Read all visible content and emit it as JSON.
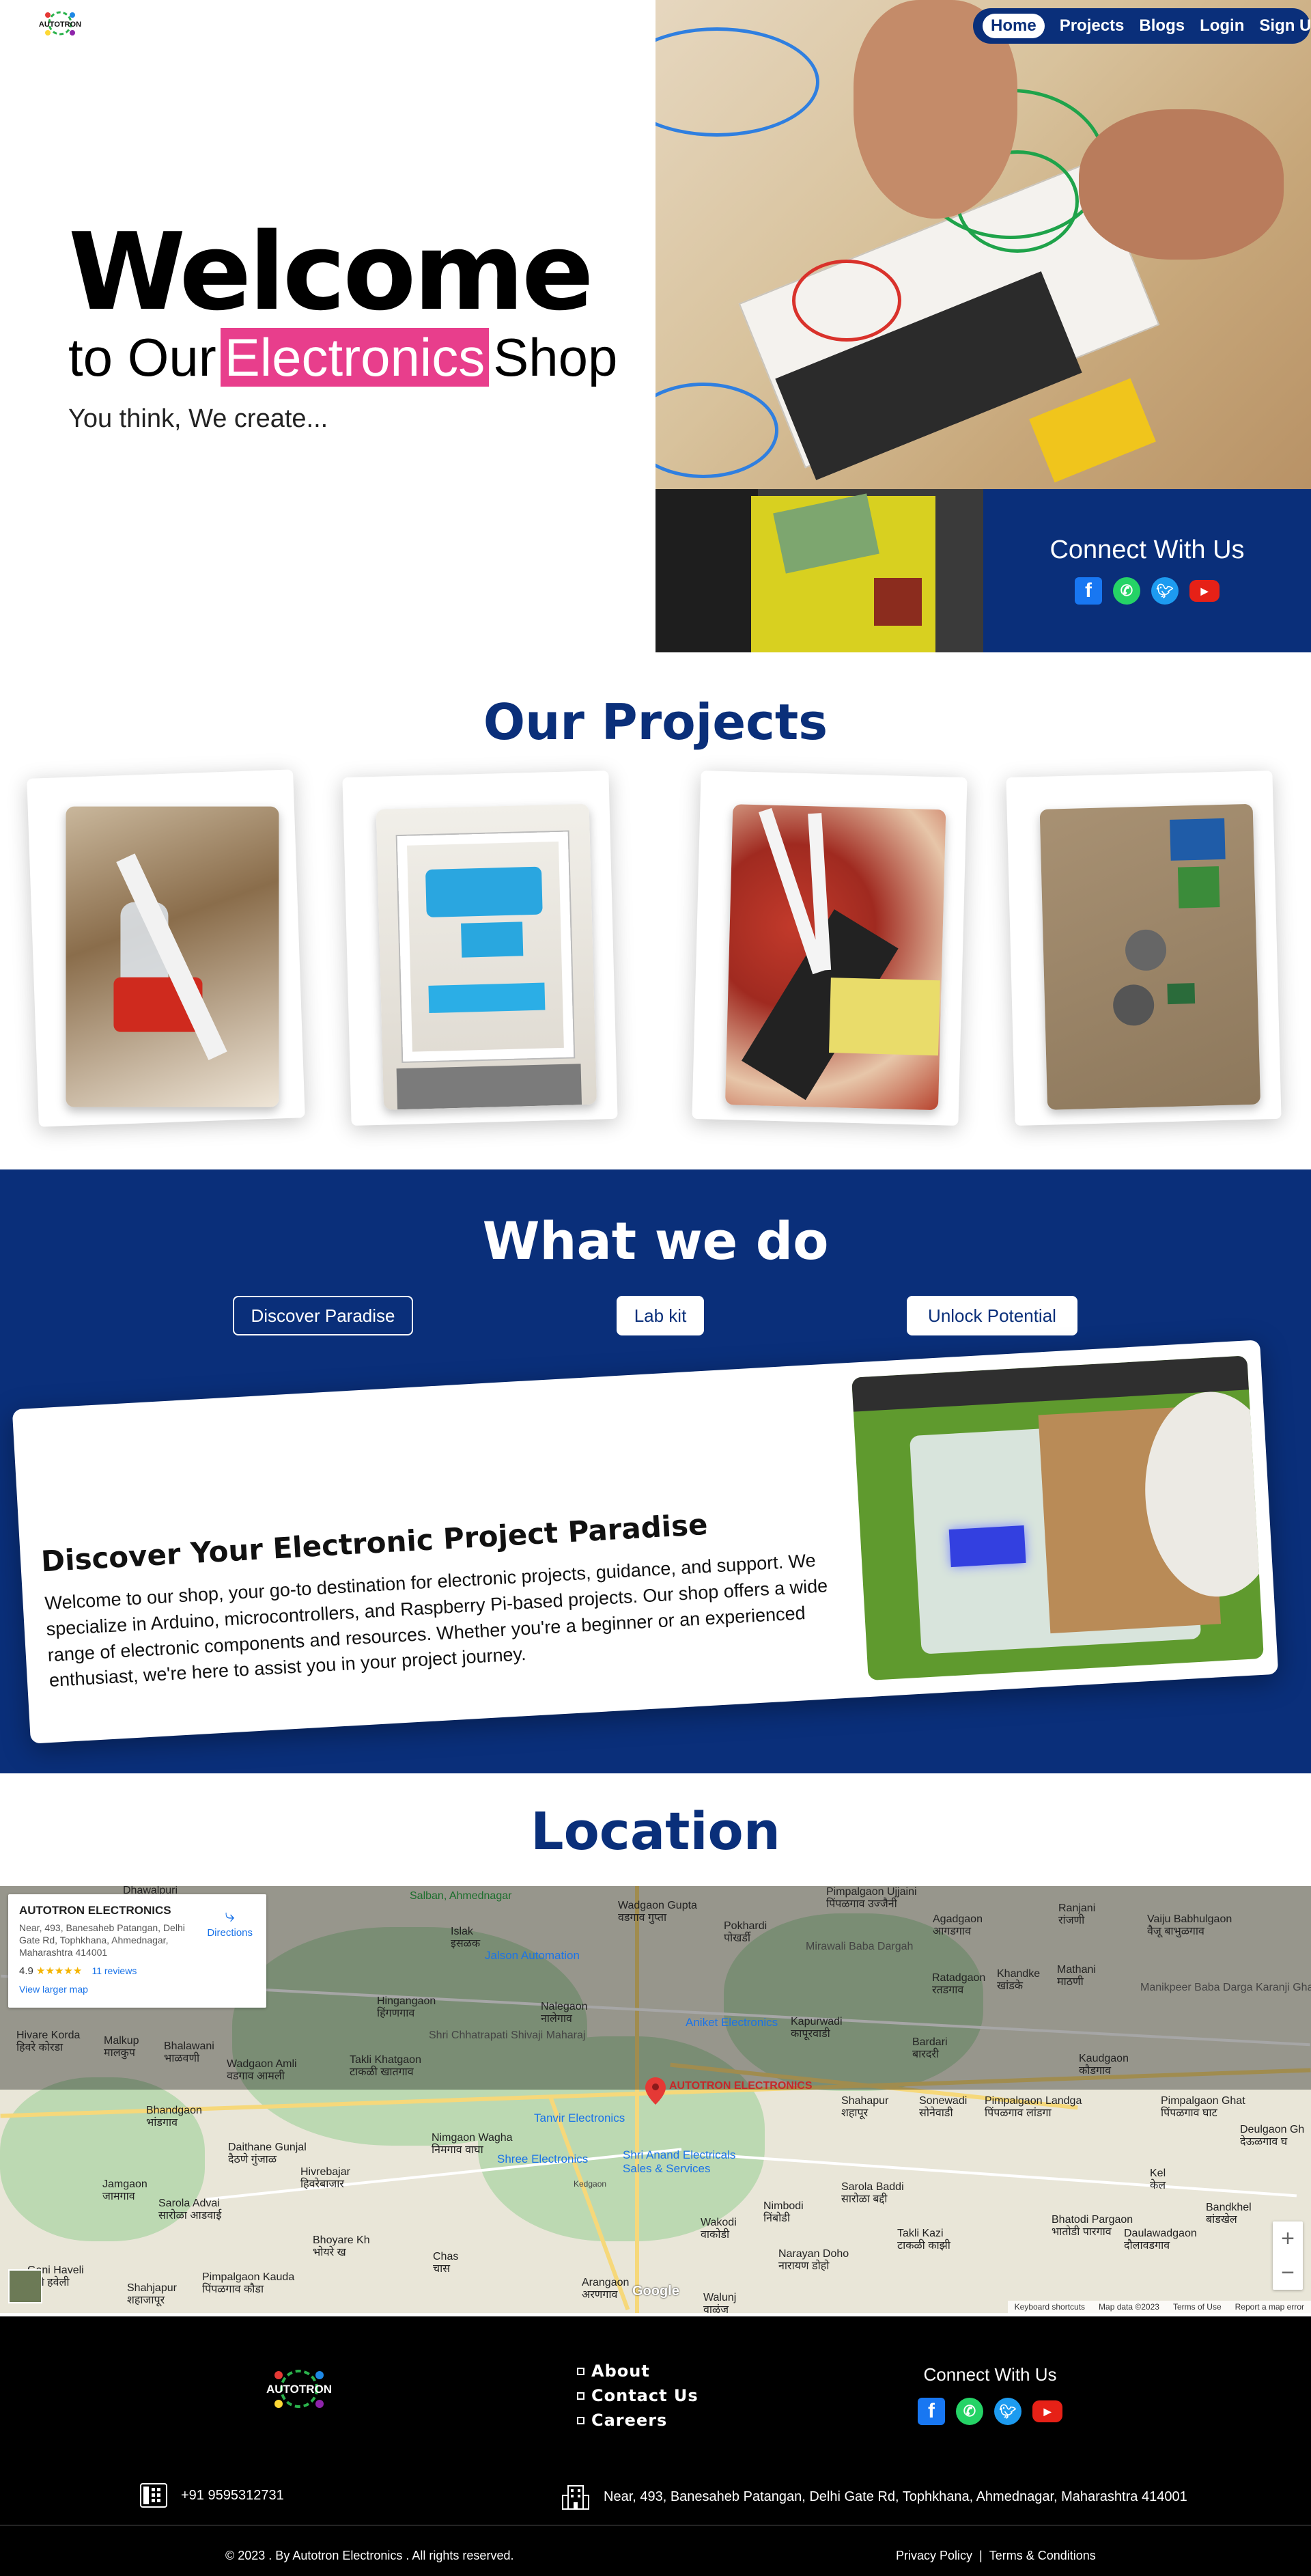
{
  "nav": {
    "items": [
      "Home",
      "Projects",
      "Blogs",
      "Login",
      "Sign Up"
    ],
    "active": "Home"
  },
  "logo": {
    "text": "AUTOTRON"
  },
  "hero": {
    "headline": "Welcome",
    "sub_prefix": "to Our",
    "sub_highlight": "Electronics",
    "sub_suffix": "Shop",
    "tagline": "You think, We create...",
    "highlight_color": "#e83e8c"
  },
  "connect": {
    "title": "Connect With Us",
    "icons": [
      "facebook-icon",
      "whatsapp-icon",
      "twitter-icon",
      "youtube-icon"
    ]
  },
  "projects": {
    "title": "Our Projects"
  },
  "what_we_do": {
    "title": "What we do",
    "tabs": [
      "Discover Paradise",
      "Lab kit",
      "Unlock Potential"
    ],
    "selected_tab": "Discover Paradise",
    "card_title": "Discover Your Electronic Project Paradise",
    "card_text": "Welcome to our shop, your go-to destination for electronic projects, guidance, and support. We specialize in Arduino, microcontrollers, and Raspberry Pi-based projects. Our shop offers a wide range of electronic components and resources. Whether you're a beginner or an experienced enthusiast, we're here to assist you in your project journey."
  },
  "location": {
    "title": "Location",
    "map": {
      "place_name": "AUTOTRON ELECTRONICS",
      "address": "Near, 493, Banesaheb Patangan, Delhi Gate Rd, Tophkhana, Ahmednagar, Maharashtra 414001",
      "rating": "4.9",
      "stars": "★★★★★",
      "reviews": "11 reviews",
      "larger_map": "View larger map",
      "directions": "Directions",
      "pin_label": "AUTOTRON ELECTRONICS",
      "google": "Google",
      "footer_links": [
        "Keyboard shortcuts",
        "Map data ©2023",
        "Terms of Use",
        "Report a map error"
      ],
      "places": [
        {
          "name": "Dhawalpuri"
        },
        {
          "name": "Salban, Ahmednagar"
        },
        {
          "name": "Wadgaon Gupta",
          "native": "वडगाव गुप्ता"
        },
        {
          "name": "Pimpalgaon Ujjaini",
          "native": "पिंपळगाव उज्जैनी"
        },
        {
          "name": "Agadgaon",
          "native": "आगडगाव"
        },
        {
          "name": "Ranjani",
          "native": "रांजणी"
        },
        {
          "name": "Vaiju Babhulgaon",
          "native": "वैजू बाभुळगाव"
        },
        {
          "name": "Islak",
          "native": "इसळक"
        },
        {
          "name": "Pokhardi",
          "native": "पोखर्डी"
        },
        {
          "name": "Mirawali Baba Dargah"
        },
        {
          "name": "Jalson Automation"
        },
        {
          "name": "Ratadgaon",
          "native": "रतडगाव"
        },
        {
          "name": "Khandke",
          "native": "खांडके"
        },
        {
          "name": "Mathani",
          "native": "माठणी"
        },
        {
          "name": "Manikpeer Baba Darga Karanji Ghat"
        },
        {
          "name": "Hingangaon",
          "native": "हिंगणगाव"
        },
        {
          "name": "Nalegaon",
          "native": "नालेगाव"
        },
        {
          "name": "Aniket Electronics"
        },
        {
          "name": "Kapurwadi",
          "native": "कापूरवाडी"
        },
        {
          "name": "Bardari",
          "native": "बारदरी"
        },
        {
          "name": "Hivare Korda",
          "native": "हिवरे कोरडा"
        },
        {
          "name": "Malkup",
          "native": "मालकुप"
        },
        {
          "name": "Bhalawani",
          "native": "भाळवणी"
        },
        {
          "name": "Shri Chhatrapati Shivaji Maharaj"
        },
        {
          "name": "Kaudgaon",
          "native": "कौडगाव"
        },
        {
          "name": "Wadgaon Amli",
          "native": "वडगाव आमली"
        },
        {
          "name": "Takli Khatgaon",
          "native": "टाकळी खातगाव"
        },
        {
          "name": "Shahapur",
          "native": "शहापूर"
        },
        {
          "name": "Sonewadi",
          "native": "सोनेवाडी"
        },
        {
          "name": "Pimpalgaon Landga",
          "native": "पिंपळगाव लांडगा"
        },
        {
          "name": "Pimpalgaon Ghat",
          "native": "पिंपळगाव घाट"
        },
        {
          "name": "Deulgaon Gh",
          "native": "देऊळगाव घ"
        },
        {
          "name": "Bhandgaon",
          "native": "भांडगाव"
        },
        {
          "name": "Tanvir Electronics"
        },
        {
          "name": "Shree Electronics"
        },
        {
          "name": "Shri Anand Electricals Sales & Services"
        },
        {
          "name": "Daithane Gunjal",
          "native": "दैठणे गुंजाळ"
        },
        {
          "name": "Hivrebajar",
          "native": "हिवरेबाजार"
        },
        {
          "name": "Nimgaon Wagha",
          "native": "निमगाव वाघा"
        },
        {
          "name": "Kedgaon",
          "native": "केडगाव"
        },
        {
          "name": "Kel",
          "native": "केल"
        },
        {
          "name": "Jamgaon",
          "native": "जामगाव"
        },
        {
          "name": "Sarola Advai",
          "native": "सारोळा आडवाई"
        },
        {
          "name": "Nimbodi",
          "native": "निंबोडी"
        },
        {
          "name": "Sarola Baddi",
          "native": "सारोळा बद्दी"
        },
        {
          "name": "Bhatodi Pargaon",
          "native": "भातोडी पारगाव"
        },
        {
          "name": "Bandkhel",
          "native": "बांडखेल"
        },
        {
          "name": "Wakodi",
          "native": "वाकोडी"
        },
        {
          "name": "Takli Kazi",
          "native": "टाकळी काझी"
        },
        {
          "name": "Daulawadgaon",
          "native": "दौलावडगाव"
        },
        {
          "name": "Bhoyare Kh",
          "native": "भोयरे ख"
        },
        {
          "name": "Chas",
          "native": "चास"
        },
        {
          "name": "Narayan Doho",
          "native": "नारायण डोहो"
        },
        {
          "name": "Arangaon",
          "native": "अरणगाव"
        },
        {
          "name": "Walunj",
          "native": "वाळुंज"
        },
        {
          "name": "Shahjapur",
          "native": "शहाजापूर"
        },
        {
          "name": "Pimpalgaon Kauda",
          "native": "पिंपळगाव कौडा"
        },
        {
          "name": "Gani Haveli",
          "native": "गणी हवेली"
        }
      ]
    }
  },
  "footer": {
    "links": [
      "About",
      "Contact Us",
      "Careers"
    ],
    "connect_title": "Connect With Us",
    "phone": "+91 9595312731",
    "address": "Near, 493, Banesaheb Patangan, Delhi Gate Rd, Tophkhana, Ahmednagar, Maharashtra 414001",
    "copyright": "© 2023 . By Autotron Electronics . All rights reserved.",
    "privacy": "Privacy Policy",
    "separator": "|",
    "terms": "Terms & Conditions"
  }
}
